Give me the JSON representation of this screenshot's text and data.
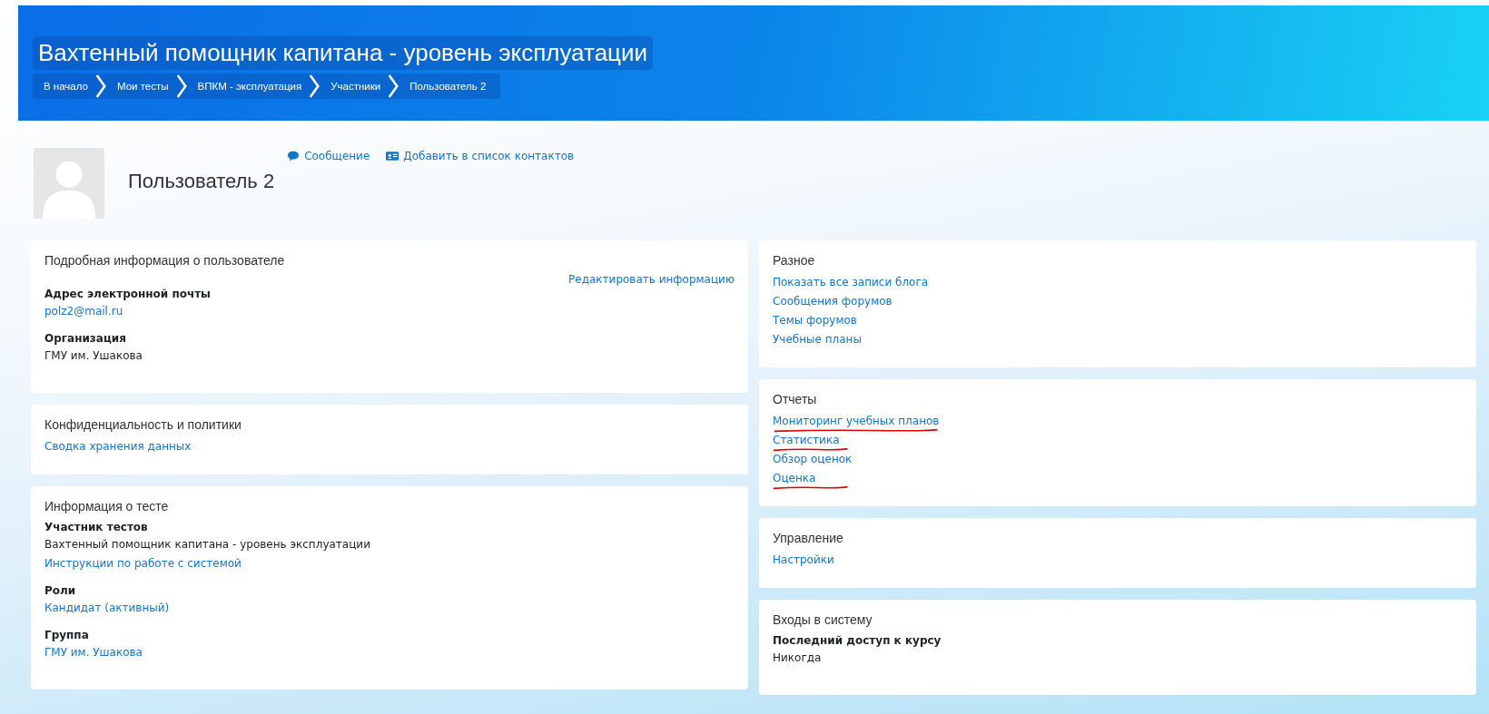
{
  "header": {
    "title": "Вахтенный помощник капитана - уровень эксплуатации",
    "breadcrumbs": [
      {
        "label": "В начало"
      },
      {
        "label": "Мои тесты"
      },
      {
        "label": "ВПКМ - эксплуатация"
      },
      {
        "label": "Участники"
      },
      {
        "label": "Пользователь 2"
      }
    ]
  },
  "profile": {
    "name": "Пользователь 2",
    "actions": [
      {
        "kind": "message",
        "label": "Сообщение"
      },
      {
        "kind": "contact",
        "label": "Добавить в список контактов"
      }
    ]
  },
  "left_cards": [
    {
      "title": "Подробная информация о пользователе",
      "edit_link": "Редактировать информацию",
      "items": [
        {
          "kind": "field",
          "label": "Адрес электронной почты",
          "values": [
            {
              "kind": "link",
              "text": "polz2@mail.ru"
            }
          ]
        },
        {
          "kind": "field",
          "label": "Организация",
          "values": [
            {
              "kind": "text",
              "text": "ГМУ им. Ушакова"
            }
          ]
        }
      ]
    },
    {
      "title": "Конфиденциальность и политики",
      "items": [
        {
          "kind": "link",
          "text": "Сводка хранения данных"
        }
      ]
    },
    {
      "title": "Информация о тесте",
      "items": [
        {
          "kind": "field",
          "label": "Участник тестов",
          "values": [
            {
              "kind": "text",
              "text": "Вахтенный помощник капитана - уровень эксплуатации"
            },
            {
              "kind": "link",
              "text": "Инструкции по работе с системой"
            }
          ]
        },
        {
          "kind": "field",
          "label": "Роли",
          "values": [
            {
              "kind": "link",
              "text": "Кандидат (активный)"
            }
          ]
        },
        {
          "kind": "field",
          "label": "Группа",
          "values": [
            {
              "kind": "link",
              "text": "ГМУ им. Ушакова"
            }
          ]
        }
      ]
    }
  ],
  "right_cards": [
    {
      "title": "Разное",
      "items": [
        {
          "kind": "link",
          "text": "Показать все записи блога",
          "marked": false
        },
        {
          "kind": "link",
          "text": "Сообщения форумов",
          "marked": false
        },
        {
          "kind": "link",
          "text": "Темы форумов",
          "marked": false
        },
        {
          "kind": "link",
          "text": "Учебные планы",
          "marked": false
        }
      ]
    },
    {
      "title": "Отчеты",
      "items": [
        {
          "kind": "link",
          "text": "Мониторинг учебных планов",
          "marked": true
        },
        {
          "kind": "link",
          "text": "Статистика",
          "marked": true
        },
        {
          "kind": "link",
          "text": "Обзор оценок",
          "marked": false
        },
        {
          "kind": "link",
          "text": "Оценка",
          "marked": true
        }
      ]
    },
    {
      "title": "Управление",
      "items": [
        {
          "kind": "link",
          "text": "Настройки",
          "marked": false
        }
      ]
    },
    {
      "title": "Входы в систему",
      "items": [
        {
          "kind": "field",
          "label": "Последний доступ к курсу",
          "values": [
            {
              "kind": "text",
              "text": "Никогда"
            }
          ]
        }
      ]
    }
  ]
}
